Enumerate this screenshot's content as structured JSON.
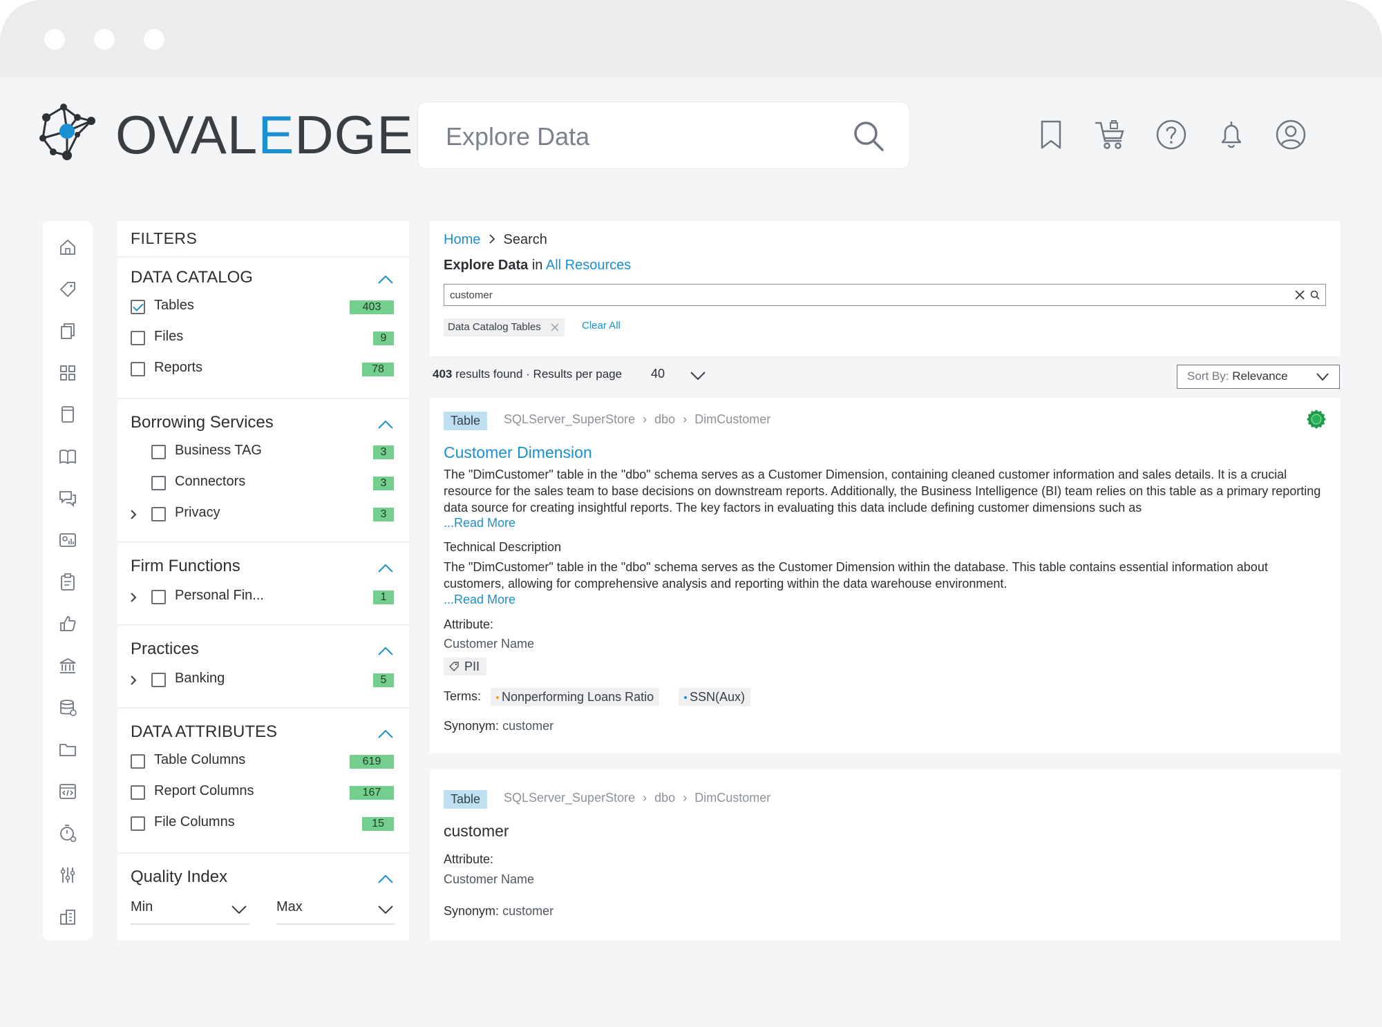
{
  "brand": {
    "logo_prefix": "OVAL",
    "logo_e": "E",
    "logo_suffix": "DGE"
  },
  "header": {
    "search_placeholder": "Explore Data",
    "icons": [
      "bookmark-icon",
      "cart-icon",
      "help-icon",
      "bell-icon",
      "user-icon"
    ]
  },
  "rail_icons": [
    "home-icon",
    "tag-icon",
    "copy-icon",
    "grid-icon",
    "book-icon",
    "open-book-icon",
    "chat-icon",
    "image-icon",
    "clipboard-icon",
    "thumbs-up-icon",
    "bank-icon",
    "database-icon",
    "folder-icon",
    "code-icon",
    "timer-icon",
    "settings-icon",
    "building-icon"
  ],
  "filters": {
    "title": "FILTERS",
    "data_catalog": {
      "title": "DATA CATALOG",
      "items": [
        {
          "label": "Tables",
          "count": "403",
          "checked": true
        },
        {
          "label": "Files",
          "count": "9",
          "checked": false
        },
        {
          "label": "Reports",
          "count": "78",
          "checked": false
        }
      ]
    },
    "borrowing": {
      "title": "Borrowing Services",
      "items": [
        {
          "label": "Business TAG",
          "count": "3"
        },
        {
          "label": "Connectors",
          "count": "3"
        },
        {
          "label": "Privacy",
          "count": "3"
        }
      ]
    },
    "firm": {
      "title": "Firm Functions",
      "items": [
        {
          "label": "Personal Fin...",
          "count": "1"
        }
      ]
    },
    "practices": {
      "title": "Practices",
      "items": [
        {
          "label": "Banking",
          "count": "5"
        }
      ]
    },
    "data_attributes": {
      "title": "DATA ATTRIBUTES",
      "items": [
        {
          "label": "Table Columns",
          "count": "619"
        },
        {
          "label": "Report Columns",
          "count": "167"
        },
        {
          "label": "File Columns",
          "count": "15"
        }
      ]
    },
    "quality": {
      "title": "Quality Index",
      "min": "Min",
      "max": "Max"
    }
  },
  "main": {
    "breadcrumb": {
      "home": "Home",
      "current": "Search"
    },
    "explore_prefix": "Explore Data",
    "explore_in": "in",
    "explore_scope": "All Resources",
    "search_value": "customer",
    "chip": "Data Catalog Tables",
    "clear_all": "Clear All",
    "results_count": "403",
    "results_text": "results found · Results per page",
    "per_page": "40",
    "sort_label": "Sort By:",
    "sort_value": "Relevance"
  },
  "results": [
    {
      "type": "Table",
      "path": [
        "SQLServer_SuperStore",
        "dbo",
        "DimCustomer"
      ],
      "title": "Customer Dimension",
      "description": "The \"DimCustomer\" table in the \"dbo\" schema serves as a Customer Dimension, containing cleaned customer information and sales details. It is a crucial resource for the sales team to base decisions on downstream reports. Additionally, the Business Intelligence (BI) team relies on this table as a primary reporting data source for creating insightful reports. The key factors in evaluating this data include defining customer dimensions such as",
      "read_more": "...Read More",
      "tech_title": "Technical Description",
      "tech_description": "The \"DimCustomer\" table in the \"dbo\" schema serves as the Customer Dimension within the database. This table contains essential information about customers, allowing for comprehensive analysis and reporting within the data warehouse environment.",
      "attribute_label": "Attribute:",
      "attribute_value": "Customer Name",
      "pii": "PII",
      "terms_label": "Terms:",
      "terms": [
        {
          "label": "Nonperforming Loans Ratio",
          "color": "#f0a020"
        },
        {
          "label": "SSN(Aux)",
          "color": "#1a8fd1"
        }
      ],
      "synonym_label": "Synonym:",
      "synonym_value": "customer"
    },
    {
      "type": "Table",
      "path": [
        "SQLServer_SuperStore",
        "dbo",
        "DimCustomer"
      ],
      "title": "customer",
      "attribute_label": "Attribute:",
      "attribute_value": "Customer Name",
      "synonym_label": "Synonym:",
      "synonym_value": "customer"
    }
  ],
  "colors": {
    "accent": "#1a8fd1",
    "count_badge": "#74cf8e",
    "tag_bg": "#bfe0f0",
    "cert": "#1f9a4a"
  }
}
